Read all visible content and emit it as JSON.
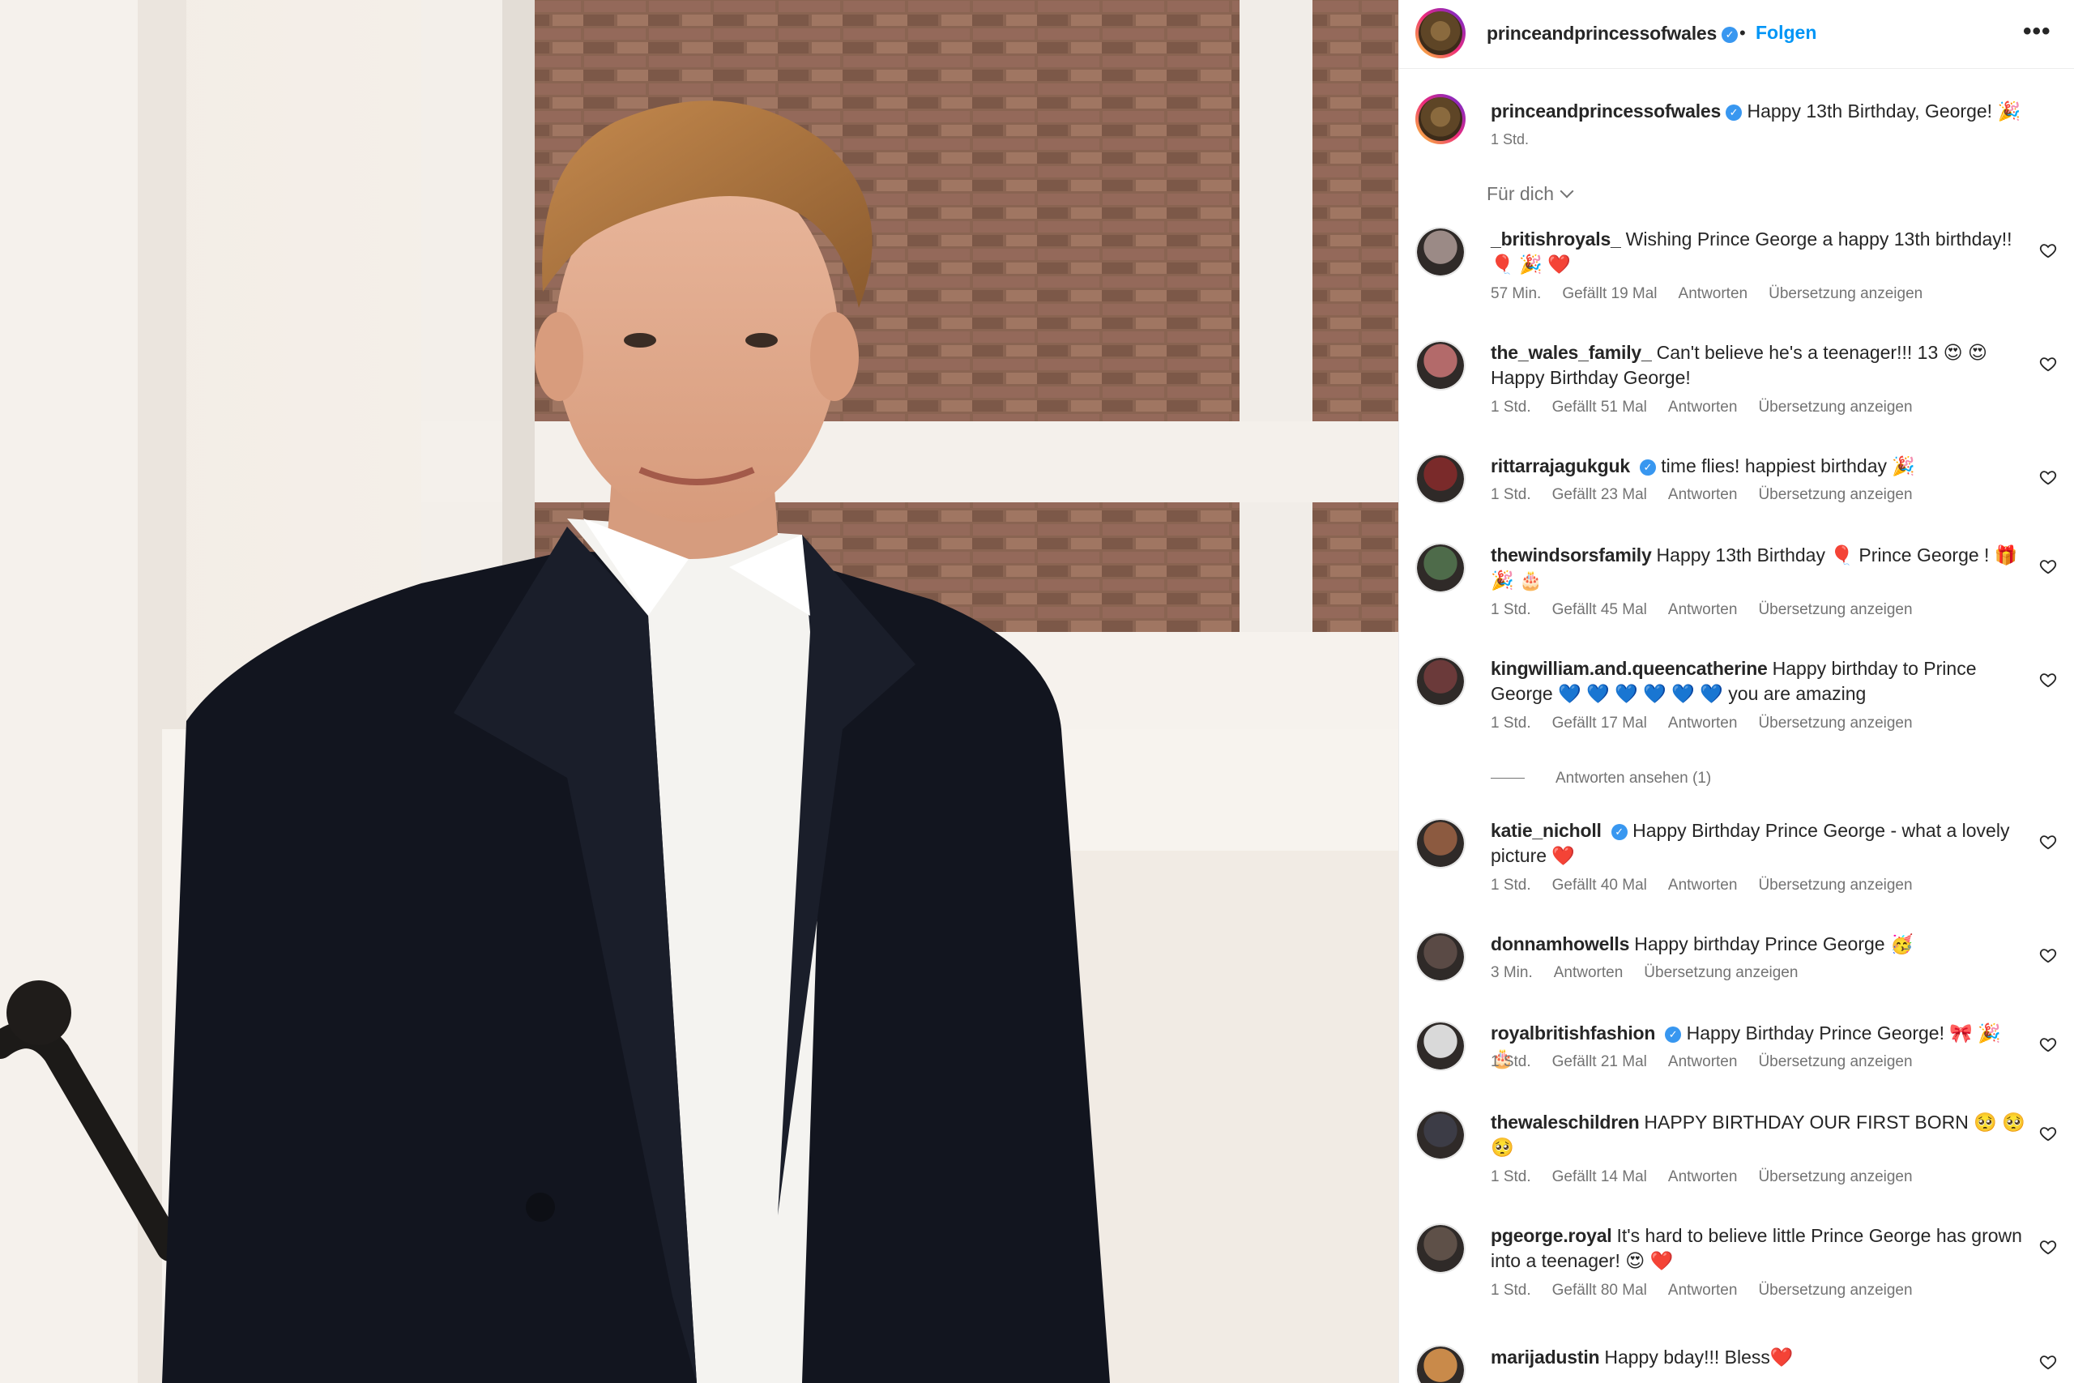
{
  "post": {
    "username": "princeandprincessofwales",
    "follow_label": "Folgen",
    "more_label": "•••",
    "caption_text": "Happy 13th Birthday, George! 🎉",
    "caption_time": "1 Std.",
    "filter_label": "Für dich"
  },
  "labels": {
    "reply": "Antworten",
    "translate": "Übersetzung anzeigen",
    "view_replies": "Antworten ansehen (1)"
  },
  "comments": [
    {
      "user": "_britishroyals_",
      "verified": false,
      "text": "Wishing Prince George a happy 13th birthday!! 🎈 🎉 ❤️",
      "time": "57 Min.",
      "likes": "Gefällt 19 Mal",
      "avatar": "#9b8a86"
    },
    {
      "user": "the_wales_family_",
      "verified": false,
      "text": "Can't believe he's a teenager!!! 13 😍 😍 Happy Birthday George!",
      "time": "1 Std.",
      "likes": "Gefällt 51 Mal",
      "avatar": "#b36a6a"
    },
    {
      "user": "rittarrajagukguk",
      "verified": true,
      "text": "time flies! happiest birthday 🎉",
      "time": "1 Std.",
      "likes": "Gefällt 23 Mal",
      "avatar": "#7a2a2a"
    },
    {
      "user": "thewindsorsfamily",
      "verified": false,
      "text": "Happy 13th Birthday 🎈 Prince George ! 🎁 🎉 🎂",
      "time": "1 Std.",
      "likes": "Gefällt 45 Mal",
      "avatar": "#4e6b4a"
    },
    {
      "user": "kingwilliam.and.queencatherine",
      "verified": false,
      "text": "Happy birthday to Prince George 💙 💙 💙 💙 💙 💙 you are amazing",
      "time": "1 Std.",
      "likes": "Gefällt 17 Mal",
      "avatar": "#6b3a3a"
    },
    {
      "user": "katie_nicholl",
      "verified": true,
      "text": "Happy Birthday Prince George - what a lovely picture ❤️",
      "time": "1 Std.",
      "likes": "Gefällt 40 Mal",
      "avatar": "#8c5a40"
    },
    {
      "user": "donnamhowells",
      "verified": false,
      "text": "Happy birthday Prince George 🥳",
      "time": "3 Min.",
      "likes": "",
      "avatar": "#5a4a45"
    },
    {
      "user": "royalbritishfashion",
      "verified": true,
      "text": "Happy Birthday Prince George! 🎀 🎉 🎂",
      "time": "1 Std.",
      "likes": "Gefällt 21 Mal",
      "avatar": "#d9d9d9"
    },
    {
      "user": "thewaleschildren",
      "verified": false,
      "text": "HAPPY BIRTHDAY OUR FIRST BORN 🥺 🥺 🥺",
      "time": "1 Std.",
      "likes": "Gefällt 14 Mal",
      "avatar": "#3c3c46"
    },
    {
      "user": "pgeorge.royal",
      "verified": false,
      "text": "It's hard to believe little Prince George has grown into a teenager! 😍 ❤️",
      "time": "1 Std.",
      "likes": "Gefällt 80 Mal",
      "avatar": "#5e5048"
    },
    {
      "user": "marijadustin",
      "verified": false,
      "text": "Happy bday!!! Bless❤️",
      "time": "",
      "likes": "",
      "avatar": "#c98a4a"
    }
  ]
}
